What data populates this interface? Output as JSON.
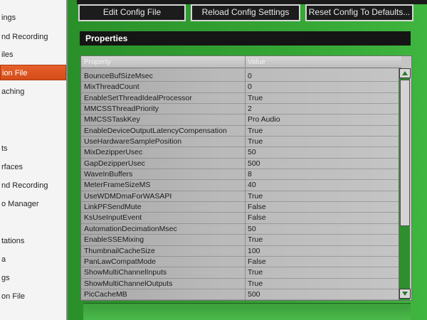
{
  "sidebar": {
    "items": [
      {
        "label": "ings",
        "active": false
      },
      {
        "label": "nd Recording",
        "active": false
      },
      {
        "label": "iles",
        "active": false
      },
      {
        "label": "ion File",
        "active": true
      },
      {
        "label": "aching",
        "active": false
      },
      {
        "label": "ts",
        "active": false
      },
      {
        "label": "rfaces",
        "active": false
      },
      {
        "label": "nd Recording",
        "active": false
      },
      {
        "label": "o Manager",
        "active": false
      },
      {
        "label": "tations",
        "active": false
      },
      {
        "label": "a",
        "active": false
      },
      {
        "label": "gs",
        "active": false
      },
      {
        "label": "on File",
        "active": false
      }
    ]
  },
  "toolbar": {
    "edit_label": "Edit Config File",
    "reload_label": "Reload Config Settings",
    "reset_label": "Reset Config To Defaults..."
  },
  "properties": {
    "title": "Properties",
    "columns": {
      "property": "Property",
      "value": "Value"
    },
    "rows": [
      {
        "property": "BounceBufSizeMsec",
        "value": "0"
      },
      {
        "property": "MixThreadCount",
        "value": "0"
      },
      {
        "property": "EnableSetThreadIdealProcessor",
        "value": "True"
      },
      {
        "property": "MMCSSThreadPriority",
        "value": "2"
      },
      {
        "property": "MMCSSTaskKey",
        "value": "Pro Audio"
      },
      {
        "property": "EnableDeviceOutputLatencyCompensation",
        "value": "True"
      },
      {
        "property": "UseHardwareSamplePosition",
        "value": "True"
      },
      {
        "property": "MixDezipperUsec",
        "value": "50"
      },
      {
        "property": "GapDezipperUsec",
        "value": "500"
      },
      {
        "property": "WaveInBuffers",
        "value": "8"
      },
      {
        "property": "MeterFrameSizeMS",
        "value": "40"
      },
      {
        "property": "UseWDMDmaForWASAPI",
        "value": "True"
      },
      {
        "property": "LinkPFSendMute",
        "value": "False"
      },
      {
        "property": "KsUseInputEvent",
        "value": "False"
      },
      {
        "property": "AutomationDecimationMsec",
        "value": "50"
      },
      {
        "property": "EnableSSEMixing",
        "value": "True"
      },
      {
        "property": "ThumbnailCacheSize",
        "value": "100"
      },
      {
        "property": "PanLawCompatMode",
        "value": "False"
      },
      {
        "property": "ShowMultiChannelInputs",
        "value": "True"
      },
      {
        "property": "ShowMultiChannelOutputs",
        "value": "True"
      },
      {
        "property": "PicCacheMB",
        "value": "500"
      }
    ]
  },
  "icons": {
    "scroll_up": "scroll-up-arrow-icon",
    "scroll_down": "scroll-down-arrow-icon"
  },
  "colors": {
    "panel_green": "#2f9a2f",
    "active_orange": "#e7602a",
    "header_dark": "#151515"
  }
}
